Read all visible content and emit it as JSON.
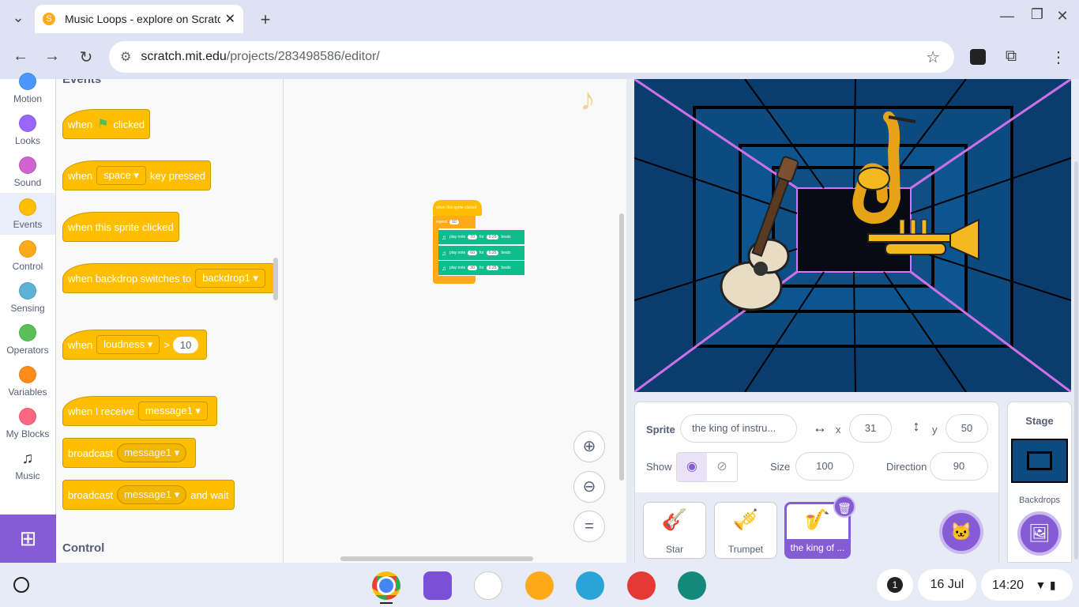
{
  "browser": {
    "tab_title": "Music Loops - explore on Scratc",
    "url_domain": "scratch.mit.edu",
    "url_path": "/projects/283498586/editor/"
  },
  "categories": [
    {
      "label": "Motion",
      "color": "#4c97ff"
    },
    {
      "label": "Looks",
      "color": "#9966ff"
    },
    {
      "label": "Sound",
      "color": "#cf63cf"
    },
    {
      "label": "Events",
      "color": "#ffbf00"
    },
    {
      "label": "Control",
      "color": "#ffab19"
    },
    {
      "label": "Sensing",
      "color": "#5cb1d6"
    },
    {
      "label": "Operators",
      "color": "#59c059"
    },
    {
      "label": "Variables",
      "color": "#ff8c1a"
    },
    {
      "label": "My Blocks",
      "color": "#ff6680"
    },
    {
      "label": "Music",
      "color": "#0fbd8c"
    }
  ],
  "palette": {
    "section_events": "Events",
    "section_control": "Control",
    "blocks": {
      "flag_when": "when",
      "flag_clicked": "clicked",
      "key_when": "when",
      "key_value": "space",
      "key_pressed": "key pressed",
      "sprite_clicked": "when this sprite clicked",
      "backdrop_switch": "when backdrop switches to",
      "backdrop_value": "backdrop1",
      "loud_when": "when",
      "loud_value": "loudness",
      "loud_gt": ">",
      "loud_num": "10",
      "receive": "when I receive",
      "receive_value": "message1",
      "broadcast": "broadcast",
      "broadcast_value": "message1",
      "broadcast_wait": "broadcast",
      "broadcast_wait_value": "message1",
      "and_wait": "and wait"
    }
  },
  "workspace": {
    "hat": "when this sprite clicked",
    "repeat": "repeat",
    "repeat_count": "10",
    "notes": [
      {
        "play": "play note",
        "note": "70",
        "for": "for",
        "beats": "0.25",
        "unit": "beats"
      },
      {
        "play": "play note",
        "note": "60",
        "for": "for",
        "beats": "0.25",
        "unit": "beats"
      },
      {
        "play": "play note",
        "note": "30",
        "for": "for",
        "beats": "0.25",
        "unit": "beats"
      }
    ]
  },
  "sprite_info": {
    "sprite_label": "Sprite",
    "sprite_name": "the king of instru...",
    "x_label": "x",
    "x_value": "31",
    "y_label": "y",
    "y_value": "50",
    "show_label": "Show",
    "size_label": "Size",
    "size_value": "100",
    "direction_label": "Direction",
    "direction_value": "90"
  },
  "sprites": [
    {
      "name": "Star"
    },
    {
      "name": "Trumpet"
    },
    {
      "name": "the king of ..."
    }
  ],
  "stage_panel": {
    "title": "Stage",
    "backdrops_label": "Backdrops"
  },
  "shelf": {
    "notification_count": "1",
    "date": "16 Jul",
    "time": "14:20"
  }
}
